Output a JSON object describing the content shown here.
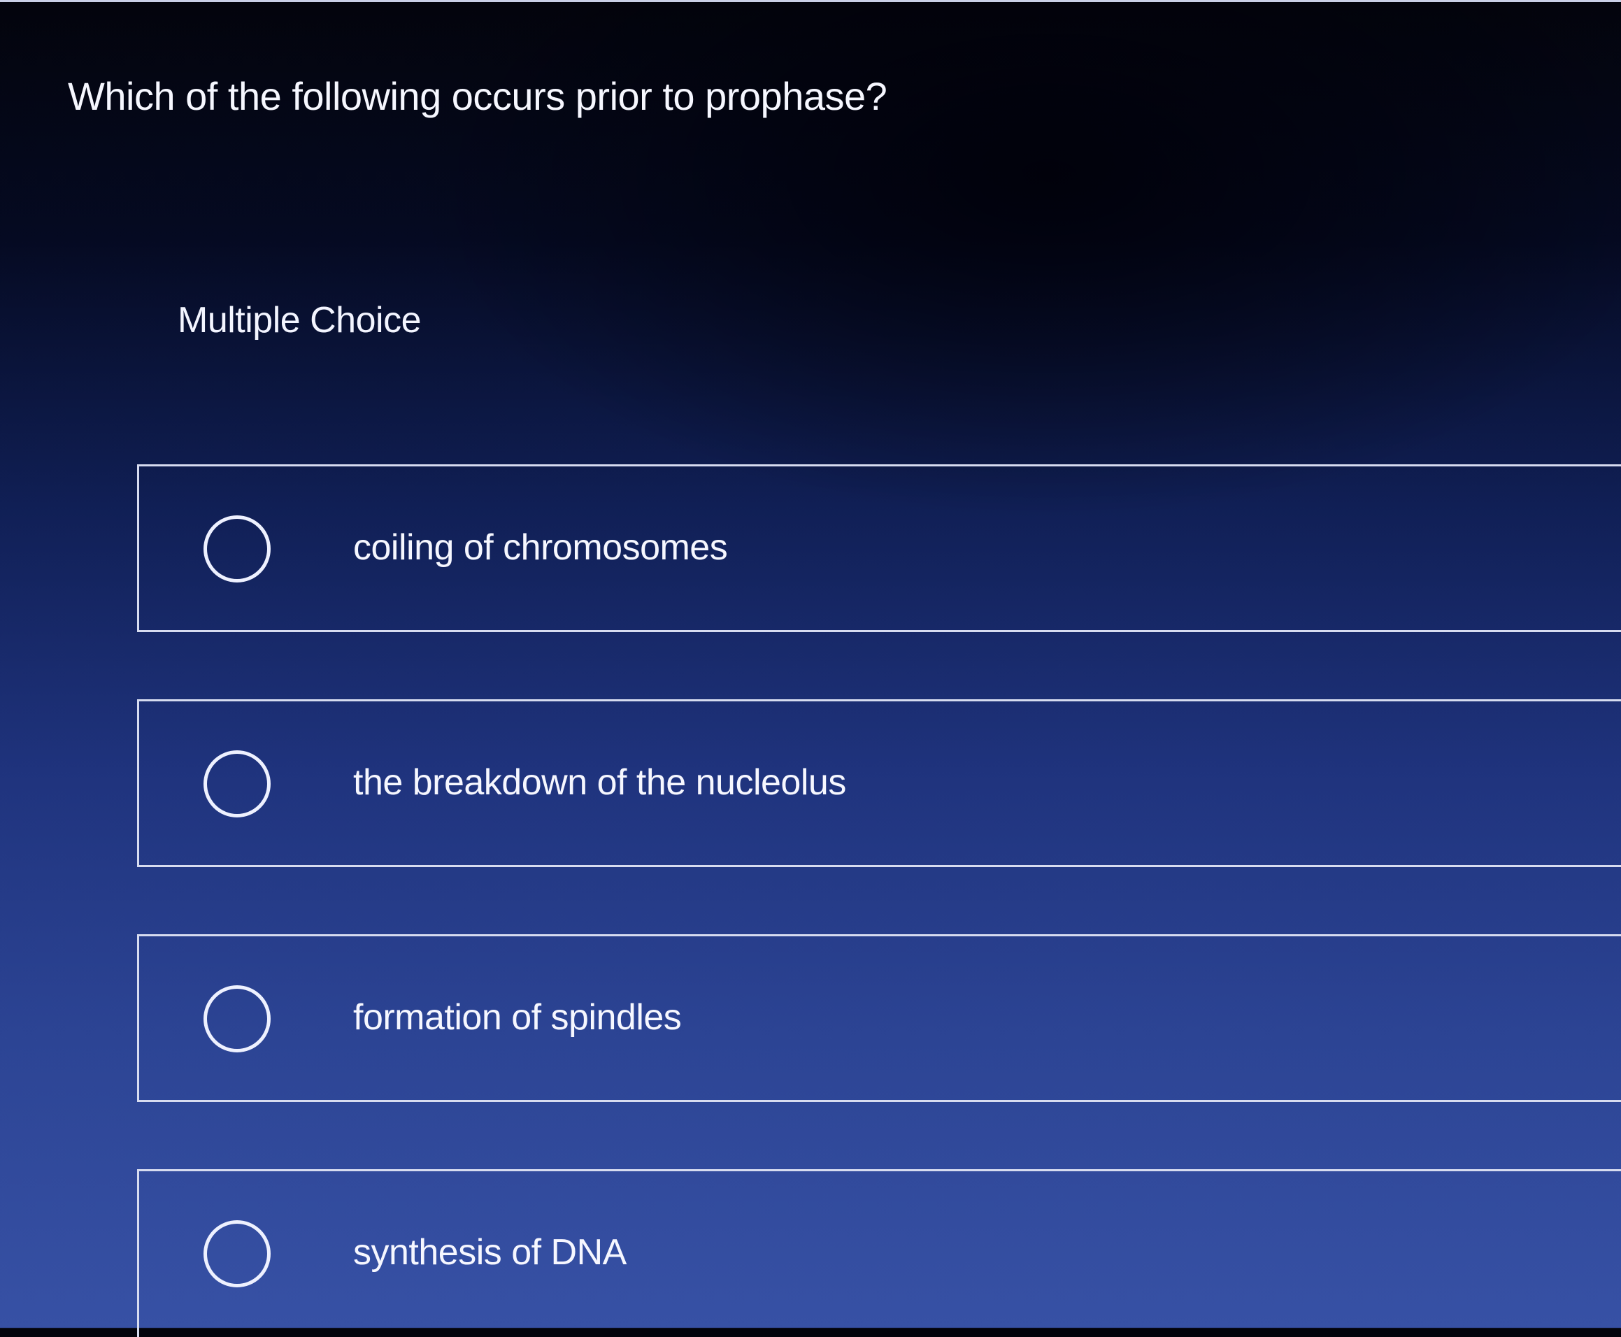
{
  "question": {
    "text": "Which of the following occurs prior to prophase?",
    "type_label": "Multiple Choice"
  },
  "choices": [
    {
      "label": "coiling of chromosomes",
      "selected": false
    },
    {
      "label": "the breakdown of the nucleolus",
      "selected": false
    },
    {
      "label": "formation of spindles",
      "selected": false
    },
    {
      "label": "synthesis of DNA",
      "selected": false
    }
  ],
  "colors": {
    "background_top": "#03040c",
    "background_bottom": "#3751a5",
    "text": "#f6f7ff",
    "border": "#d7dcf0"
  }
}
